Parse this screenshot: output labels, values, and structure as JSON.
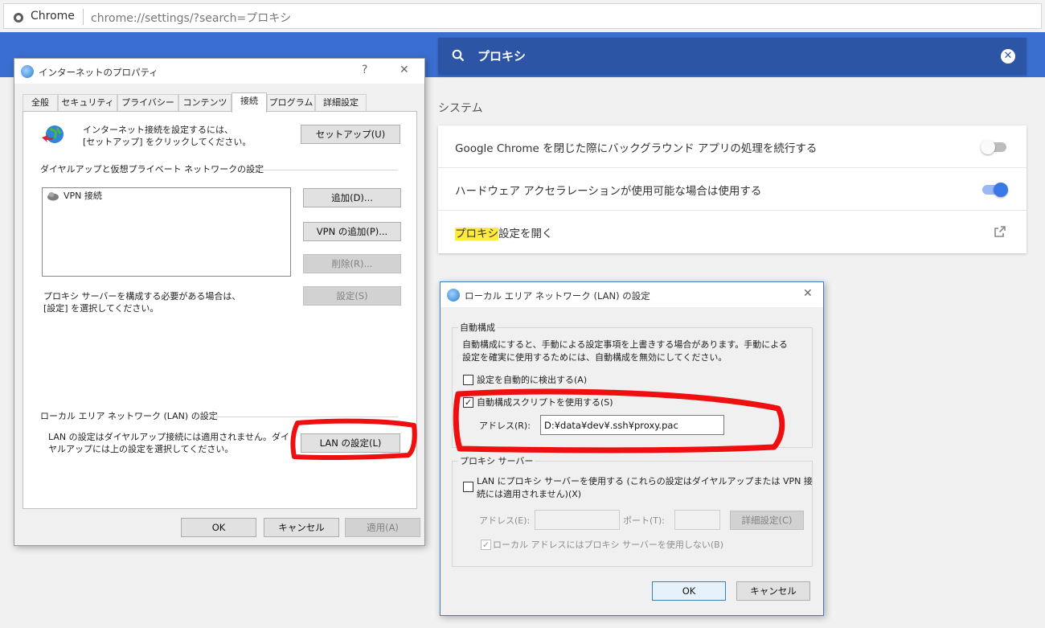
{
  "browser": {
    "app_name": "Chrome",
    "url": "chrome://settings/?search=プロキシ"
  },
  "search": {
    "query": "プロキシ"
  },
  "settings": {
    "section_title": "システム",
    "rows": [
      {
        "label": "Google Chrome を閉じた際にバックグラウンド アプリの処理を続行する",
        "toggle": "off"
      },
      {
        "label": "ハードウェア アクセラレーションが使用可能な場合は使用する",
        "toggle": "on"
      },
      {
        "label_highlight": "プロキシ",
        "label_rest": "設定を開く"
      }
    ],
    "accent_color": "#3b78e7",
    "highlight_color": "#ffeb3b"
  },
  "inet_props": {
    "title": "インターネットのプロパティ",
    "help": "?",
    "close": "✕",
    "tabs": [
      "全般",
      "セキュリティ",
      "プライバシー",
      "コンテンツ",
      "接続",
      "プログラム",
      "詳細設定"
    ],
    "active_tab": "接続",
    "setup_text_1": "インターネット接続を設定するには、",
    "setup_text_2": "[セットアップ] をクリックしてください。",
    "setup_button": "セットアップ(U)",
    "dialup_group": "ダイヤルアップと仮想プライベート ネットワークの設定",
    "vpn_item": "VPN 接続",
    "add_button": "追加(D)...",
    "add_vpn_button": "VPN の追加(P)...",
    "remove_button": "削除(R)...",
    "settings_button": "設定(S)",
    "proxy_text_1": "プロキシ サーバーを構成する必要がある場合は、",
    "proxy_text_2": "[設定] を選択してください。",
    "lan_group": "ローカル エリア ネットワーク (LAN) の設定",
    "lan_text_1": "LAN の設定はダイヤルアップ接続には適用されません。ダイ",
    "lan_text_2": "ヤルアップには上の設定を選択してください。",
    "lan_button": "LAN の設定(L)",
    "ok": "OK",
    "cancel": "キャンセル",
    "apply": "適用(A)"
  },
  "lan_dialog": {
    "title": "ローカル エリア ネットワーク (LAN) の設定",
    "close": "✕",
    "auto_group": "自動構成",
    "auto_desc_1": "自動構成にすると、手動による設定事項を上書きする場合があります。手動による",
    "auto_desc_2": "設定を確実に使用するためには、自動構成を無効にしてください。",
    "auto_detect": {
      "label": "設定を自動的に検出する(A)",
      "checked": false
    },
    "use_script": {
      "label": "自動構成スクリプトを使用する(S)",
      "checked": true
    },
    "address_label": "アドレス(R):",
    "address_value": "D:¥data¥dev¥.ssh¥proxy.pac",
    "proxy_group": "プロキシ サーバー",
    "use_proxy_label_1": "LAN にプロキシ サーバーを使用する (これらの設定はダイヤルアップまたは VPN 接",
    "use_proxy_label_2": "続には適用されません)(X)",
    "proxy_address_label": "アドレス(E):",
    "port_label": "ポート(T):",
    "advanced_button": "詳細設定(C)",
    "bypass_local_label": "ローカル アドレスにはプロキシ サーバーを使用しない(B)",
    "ok": "OK",
    "cancel": "キャンセル"
  }
}
